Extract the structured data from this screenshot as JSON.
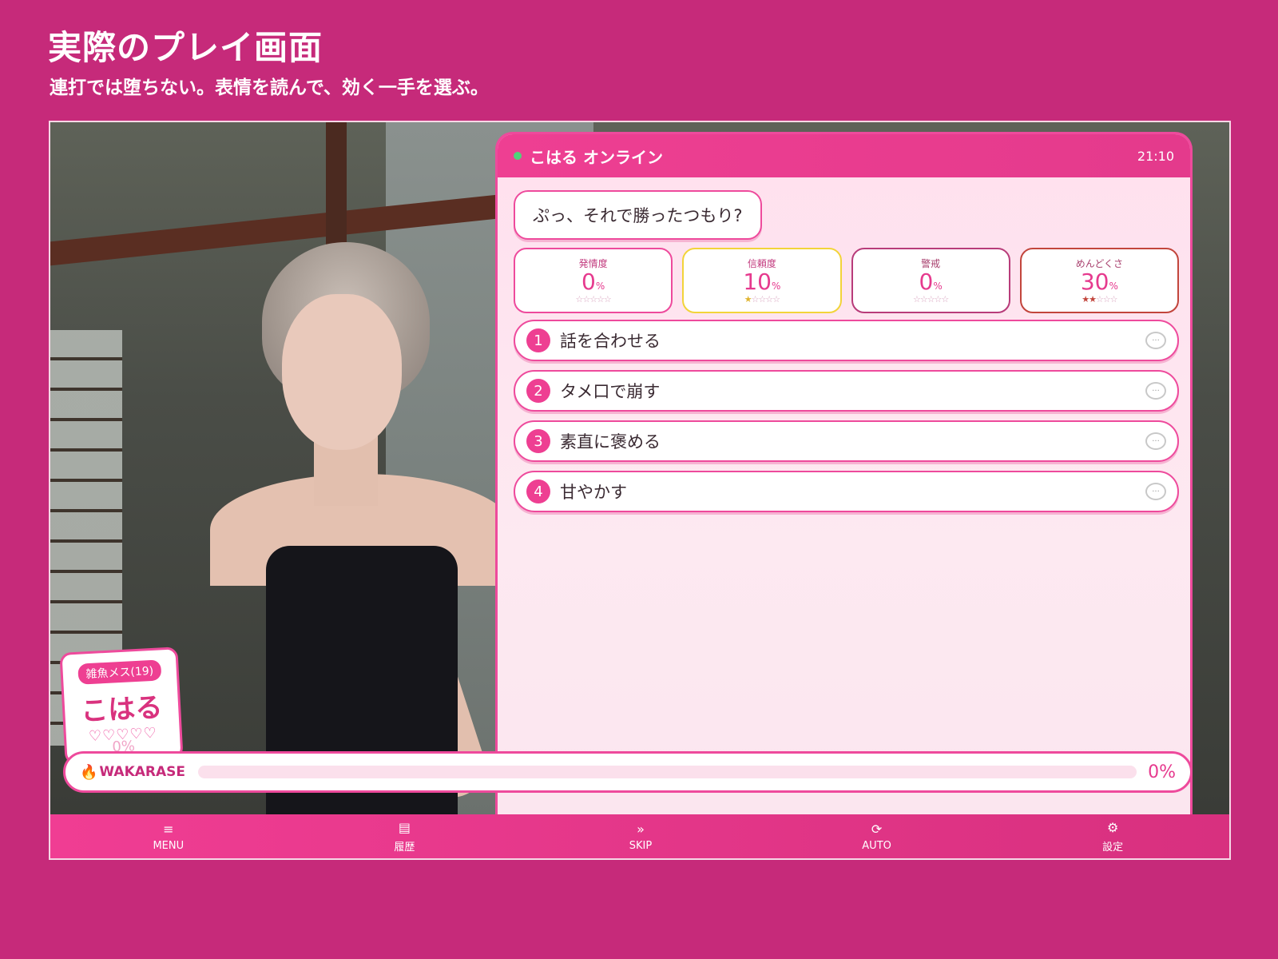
{
  "page": {
    "title": "実際のプレイ画面",
    "subtitle": "連打では堕ちない。表情を読んで、効く一手を選ぶ。"
  },
  "chat": {
    "name": "こはる オンライン",
    "time": "21:10",
    "message": "ぷっ、それで勝ったつもり?"
  },
  "stats": [
    {
      "label": "発情度",
      "value": "0",
      "unit": "%",
      "stars_on": "",
      "stars_off": "☆☆☆☆☆",
      "level": 0
    },
    {
      "label": "信頼度",
      "value": "10",
      "unit": "%",
      "stars_on": "★",
      "stars_off": "☆☆☆☆",
      "level": 1
    },
    {
      "label": "警戒",
      "value": "0",
      "unit": "%",
      "stars_on": "",
      "stars_off": "☆☆☆☆☆",
      "level": 0
    },
    {
      "label": "めんどくさ",
      "value": "30",
      "unit": "%",
      "stars_on": "★★",
      "stars_off": "☆☆☆",
      "level": 2
    }
  ],
  "choices": [
    {
      "num": "1",
      "label": "話を合わせる",
      "icon": "speech-bubble-icon"
    },
    {
      "num": "2",
      "label": "タメ口で崩す",
      "icon": "speech-bubble-icon"
    },
    {
      "num": "3",
      "label": "素直に褒める",
      "icon": "speech-bubble-icon"
    },
    {
      "num": "4",
      "label": "甘やかす",
      "icon": "speech-bubble-icon"
    }
  ],
  "namecard": {
    "tag": "雑魚メス(19)",
    "name": "こはる",
    "hearts": "♡♡♡♡♡",
    "percent": "0%"
  },
  "wakarase": {
    "icon": "🔥",
    "label": "WAKARASE",
    "percent": "0%",
    "progress": 0
  },
  "bottombar": [
    {
      "icon": "≡",
      "label": "MENU"
    },
    {
      "icon": "▤",
      "label": "履歴"
    },
    {
      "icon": "»",
      "label": "SKIP"
    },
    {
      "icon": "⟳",
      "label": "AUTO"
    },
    {
      "icon": "⚙",
      "label": "設定"
    }
  ],
  "colors": {
    "background": "#c62a7a",
    "accent": "#ee3f92",
    "online": "#4ed37a"
  }
}
